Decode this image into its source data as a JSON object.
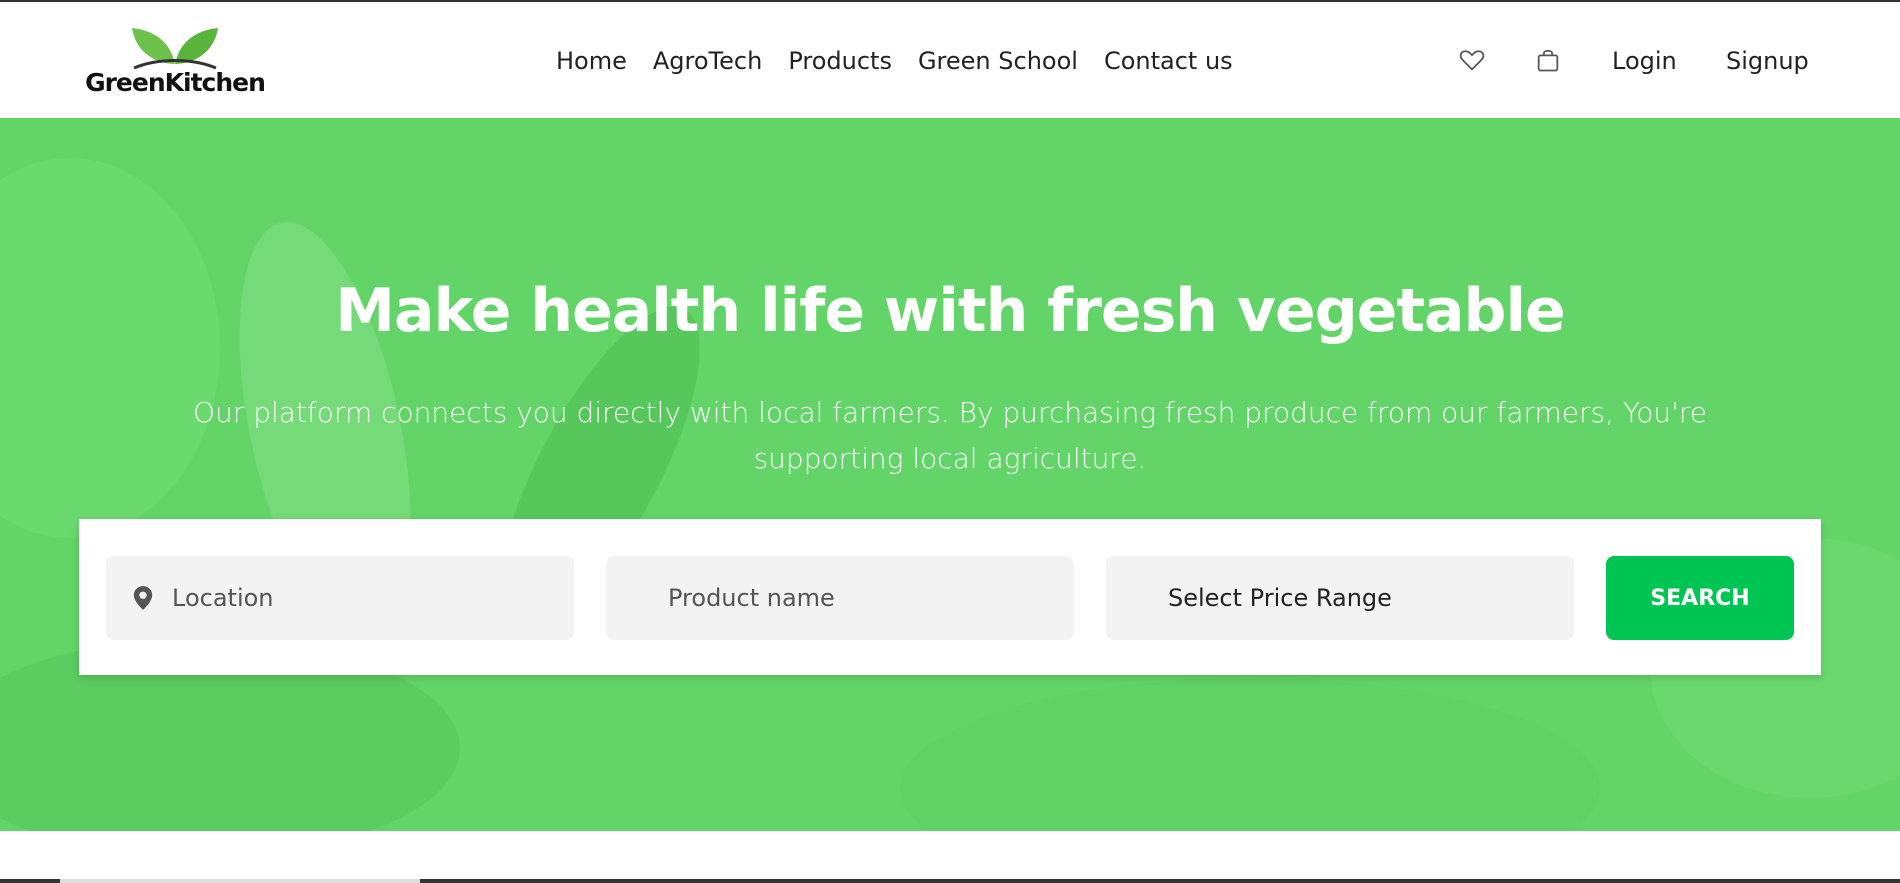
{
  "brand": {
    "name": "GreenKitchen",
    "leaf_color": "#6cc24a"
  },
  "nav": {
    "items": [
      {
        "label": "Home"
      },
      {
        "label": "AgroTech"
      },
      {
        "label": "Products"
      },
      {
        "label": "Green School"
      },
      {
        "label": "Contact us"
      }
    ]
  },
  "header_actions": {
    "wishlist_icon": "heart-icon",
    "cart_icon": "shopping-bag-icon",
    "login_label": "Login",
    "signup_label": "Signup"
  },
  "hero": {
    "title": "Make health life with fresh vegetable",
    "subtitle": "Our platform connects you directly with local farmers. By purchasing fresh produce from our farmers, You're supporting local agriculture.",
    "background_color": "#63d568"
  },
  "search": {
    "location_placeholder": "Location",
    "location_icon": "map-pin-icon",
    "product_placeholder": "Product name",
    "price_select_value": "Select Price Range",
    "search_button_label": "SEARCH",
    "button_color": "#00c553"
  }
}
